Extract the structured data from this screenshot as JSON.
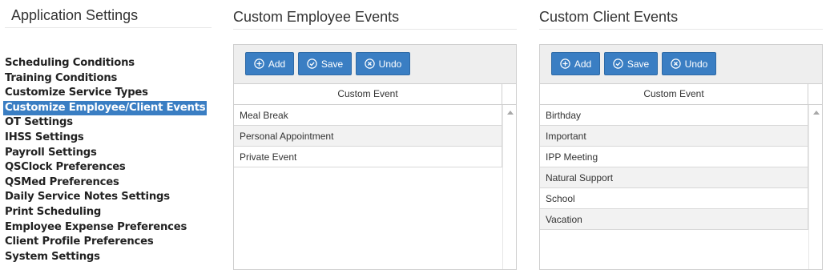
{
  "sidebar": {
    "title": "Application Settings",
    "items": [
      {
        "label": "Scheduling Conditions"
      },
      {
        "label": "Training Conditions"
      },
      {
        "label": "Customize Service Types"
      },
      {
        "label": "Customize Employee/Client Events",
        "active": true
      },
      {
        "label": "OT Settings"
      },
      {
        "label": "IHSS Settings"
      },
      {
        "label": "Payroll Settings"
      },
      {
        "label": "QSClock Preferences"
      },
      {
        "label": "QSMed Preferences"
      },
      {
        "label": "Daily Service Notes Settings"
      },
      {
        "label": "Print Scheduling"
      },
      {
        "label": "Employee Expense Preferences"
      },
      {
        "label": "Client Profile Preferences"
      },
      {
        "label": "System Settings"
      }
    ]
  },
  "employee_panel": {
    "title": "Custom Employee Events",
    "buttons": {
      "add": "Add",
      "save": "Save",
      "undo": "Undo"
    },
    "column_header": "Custom Event",
    "rows": [
      "Meal Break",
      "Personal Appointment",
      "Private Event"
    ]
  },
  "client_panel": {
    "title": "Custom Client Events",
    "buttons": {
      "add": "Add",
      "save": "Save",
      "undo": "Undo"
    },
    "column_header": "Custom Event",
    "rows": [
      "Birthday",
      "Important",
      "IPP Meeting",
      "Natural Support",
      "School",
      "Vacation"
    ]
  },
  "colors": {
    "accent": "#3a7ec3",
    "toolbar_bg": "#eeeeee",
    "alt_row": "#f2f2f2"
  },
  "icons": {
    "add": "plus-circle-icon",
    "save": "check-circle-icon",
    "undo": "x-circle-icon",
    "scroll_up": "caret-up-icon"
  }
}
